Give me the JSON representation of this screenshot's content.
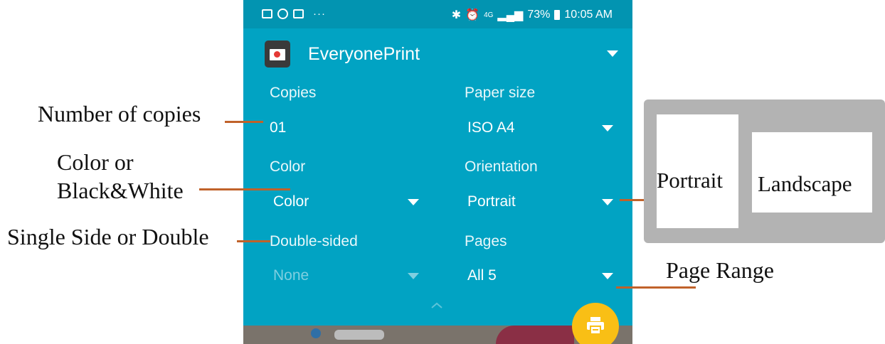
{
  "status_bar": {
    "dots": "···",
    "network": "4G",
    "battery": "73%",
    "time": "10:05 AM"
  },
  "printer": {
    "name": "EveryonePrint"
  },
  "fields": {
    "copies": {
      "label": "Copies",
      "value": "01"
    },
    "paper_size": {
      "label": "Paper size",
      "value": "ISO A4"
    },
    "color": {
      "label": "Color",
      "value": "Color"
    },
    "orientation": {
      "label": "Orientation",
      "value": "Portrait"
    },
    "double_sided": {
      "label": "Double-sided",
      "value": "None"
    },
    "pages": {
      "label": "Pages",
      "value": "All 5"
    }
  },
  "annotations": {
    "copies": "Number of copies",
    "color_line1": "Color or",
    "color_line2": "Black&White",
    "sides": "Single Side or Double",
    "page_range": "Page Range",
    "portrait": "Portrait",
    "landscape": "Landscape"
  },
  "colors": {
    "panel": "#01a3c3",
    "fab": "#f9bf15",
    "arrow": "#c0622a"
  }
}
